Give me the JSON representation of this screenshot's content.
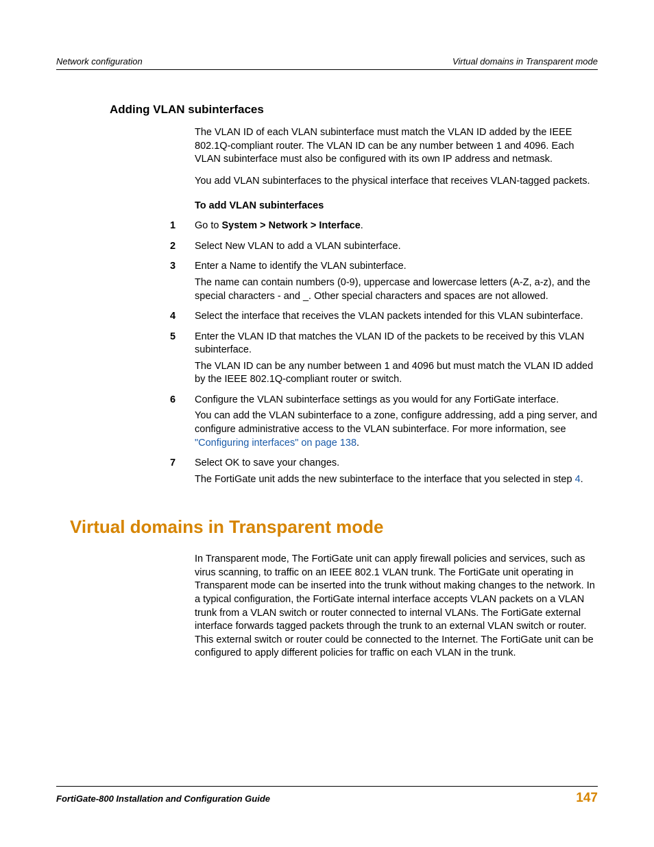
{
  "header": {
    "left": "Network configuration",
    "right": "Virtual domains in Transparent mode"
  },
  "section1": {
    "heading": "Adding VLAN subinterfaces",
    "p1": "The VLAN ID of each VLAN subinterface must match the VLAN ID added by the IEEE 802.1Q-compliant router. The VLAN ID can be any number between 1 and 4096. Each VLAN subinterface must also be configured with its own IP address and netmask.",
    "p2": "You add VLAN subinterfaces to the physical interface that receives VLAN-tagged packets.",
    "subheading": "To add VLAN subinterfaces",
    "steps": [
      {
        "num": "1",
        "pre": "Go to ",
        "bold": "System > Network > Interface",
        "post": "."
      },
      {
        "num": "2",
        "text": "Select New VLAN to add a VLAN subinterface."
      },
      {
        "num": "3",
        "text": "Enter a Name to identify the VLAN subinterface.",
        "extra": "The name can contain numbers (0-9), uppercase and lowercase letters (A-Z, a-z), and the special characters - and _. Other special characters and spaces are not allowed."
      },
      {
        "num": "4",
        "text": "Select the interface that receives the VLAN packets intended for this VLAN subinterface."
      },
      {
        "num": "5",
        "text": "Enter the VLAN ID that matches the VLAN ID of the packets to be received by this VLAN subinterface.",
        "extra": "The VLAN ID can be any number between 1 and 4096 but must match the VLAN ID added by the IEEE 802.1Q-compliant router or switch."
      },
      {
        "num": "6",
        "text": "Configure the VLAN subinterface settings as you would for any FortiGate interface.",
        "extra_pre": "You can add the VLAN subinterface to a zone, configure addressing, add a ping server, and configure administrative access to the VLAN subinterface. For more information, see ",
        "link": "\"Configuring interfaces\" on page 138",
        "extra_post": "."
      },
      {
        "num": "7",
        "text": "Select OK to save your changes.",
        "extra_pre": "The FortiGate unit adds the new subinterface to the interface that you selected in step ",
        "link": "4",
        "extra_post": "."
      }
    ]
  },
  "section2": {
    "heading": "Virtual domains in Transparent mode",
    "p1": "In Transparent mode, The FortiGate unit can apply firewall policies and services, such as virus scanning, to traffic on an IEEE 802.1 VLAN trunk. The FortiGate unit operating in Transparent mode can be inserted into the trunk without making changes to the network. In a typical configuration, the FortiGate internal interface accepts VLAN packets on a VLAN trunk from a VLAN switch or router connected to internal VLANs. The FortiGate external interface forwards tagged packets through the trunk to an external VLAN switch or router. This external switch or router could be connected to the Internet. The FortiGate unit can be configured to apply different policies for traffic on each VLAN in the trunk."
  },
  "footer": {
    "left": "FortiGate-800 Installation and Configuration Guide",
    "right": "147"
  }
}
